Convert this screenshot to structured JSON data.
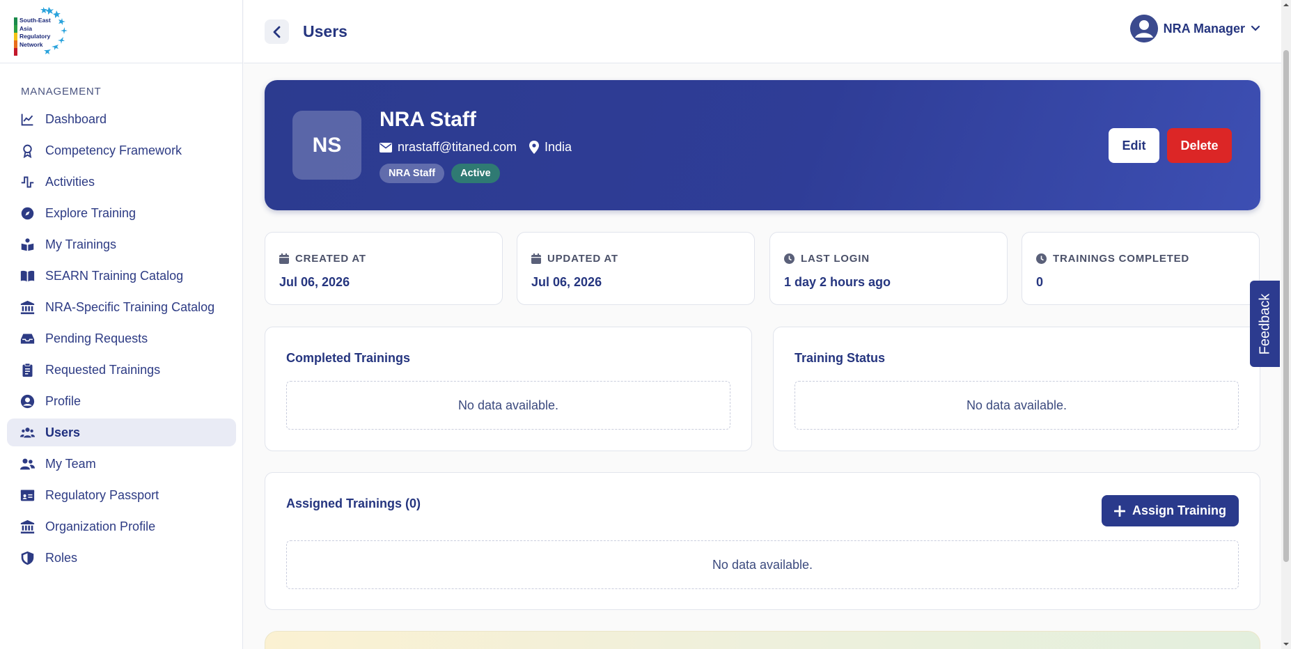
{
  "logo": {
    "text_lines": [
      "South-East",
      "Asia",
      "Regulatory",
      "Network"
    ]
  },
  "sidebar": {
    "section_label": "MANAGEMENT",
    "items": [
      {
        "label": "Dashboard",
        "icon": "chart-line-icon"
      },
      {
        "label": "Competency Framework",
        "icon": "award-icon"
      },
      {
        "label": "Activities",
        "icon": "pulse-icon"
      },
      {
        "label": "Explore Training",
        "icon": "compass-icon"
      },
      {
        "label": "My Trainings",
        "icon": "book-reader-icon"
      },
      {
        "label": "SEARN Training Catalog",
        "icon": "open-book-icon"
      },
      {
        "label": "NRA-Specific Training Catalog",
        "icon": "institution-icon"
      },
      {
        "label": "Pending Requests",
        "icon": "inbox-icon"
      },
      {
        "label": "Requested Trainings",
        "icon": "clipboard-icon"
      },
      {
        "label": "Profile",
        "icon": "user-circle-icon"
      },
      {
        "label": "Users",
        "icon": "users-icon",
        "active": true
      },
      {
        "label": "My Team",
        "icon": "team-icon"
      },
      {
        "label": "Regulatory Passport",
        "icon": "id-card-icon"
      },
      {
        "label": "Organization Profile",
        "icon": "institution-icon"
      },
      {
        "label": "Roles",
        "icon": "shield-icon"
      }
    ]
  },
  "header": {
    "title": "Users",
    "user_name": "NRA Manager"
  },
  "profile": {
    "initials": "NS",
    "name": "NRA Staff",
    "email": "nrastaff@titaned.com",
    "country": "India",
    "role_badge": "NRA Staff",
    "status_badge": "Active",
    "edit_label": "Edit",
    "delete_label": "Delete"
  },
  "stats": [
    {
      "label": "CREATED AT",
      "value": "Jul 06, 2026",
      "icon": "calendar-icon"
    },
    {
      "label": "UPDATED AT",
      "value": "Jul 06, 2026",
      "icon": "calendar-icon"
    },
    {
      "label": "LAST LOGIN",
      "value": "1 day 2 hours ago",
      "icon": "clock-icon"
    },
    {
      "label": "TRAININGS COMPLETED",
      "value": "0",
      "icon": "clock-icon"
    }
  ],
  "panels": {
    "completed": {
      "title": "Completed Trainings",
      "empty": "No data available."
    },
    "status": {
      "title": "Training Status",
      "empty": "No data available."
    },
    "assigned": {
      "title": "Assigned Trainings (0)",
      "empty": "No data available.",
      "button": "Assign Training"
    }
  },
  "feedback_label": "Feedback",
  "colors": {
    "primary": "#2c3b8f",
    "danger": "#dc2626",
    "status_active": "#2f7a73"
  }
}
